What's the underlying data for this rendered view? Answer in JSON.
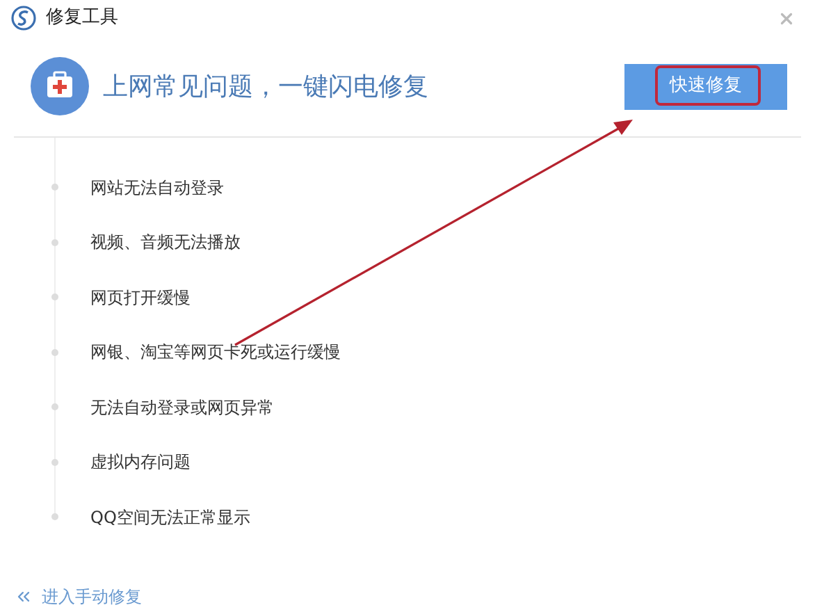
{
  "window": {
    "title": "修复工具"
  },
  "header": {
    "headline": "上网常见问题，一键闪电修复",
    "button": "快速修复"
  },
  "issues": [
    "网站无法自动登录",
    "视频、音频无法播放",
    "网页打开缓慢",
    "网银、淘宝等网页卡死或运行缓慢",
    "无法自动登录或网页异常",
    "虚拟内存问题",
    "QQ空间无法正常显示"
  ],
  "footer": {
    "link": "进入手动修复"
  }
}
